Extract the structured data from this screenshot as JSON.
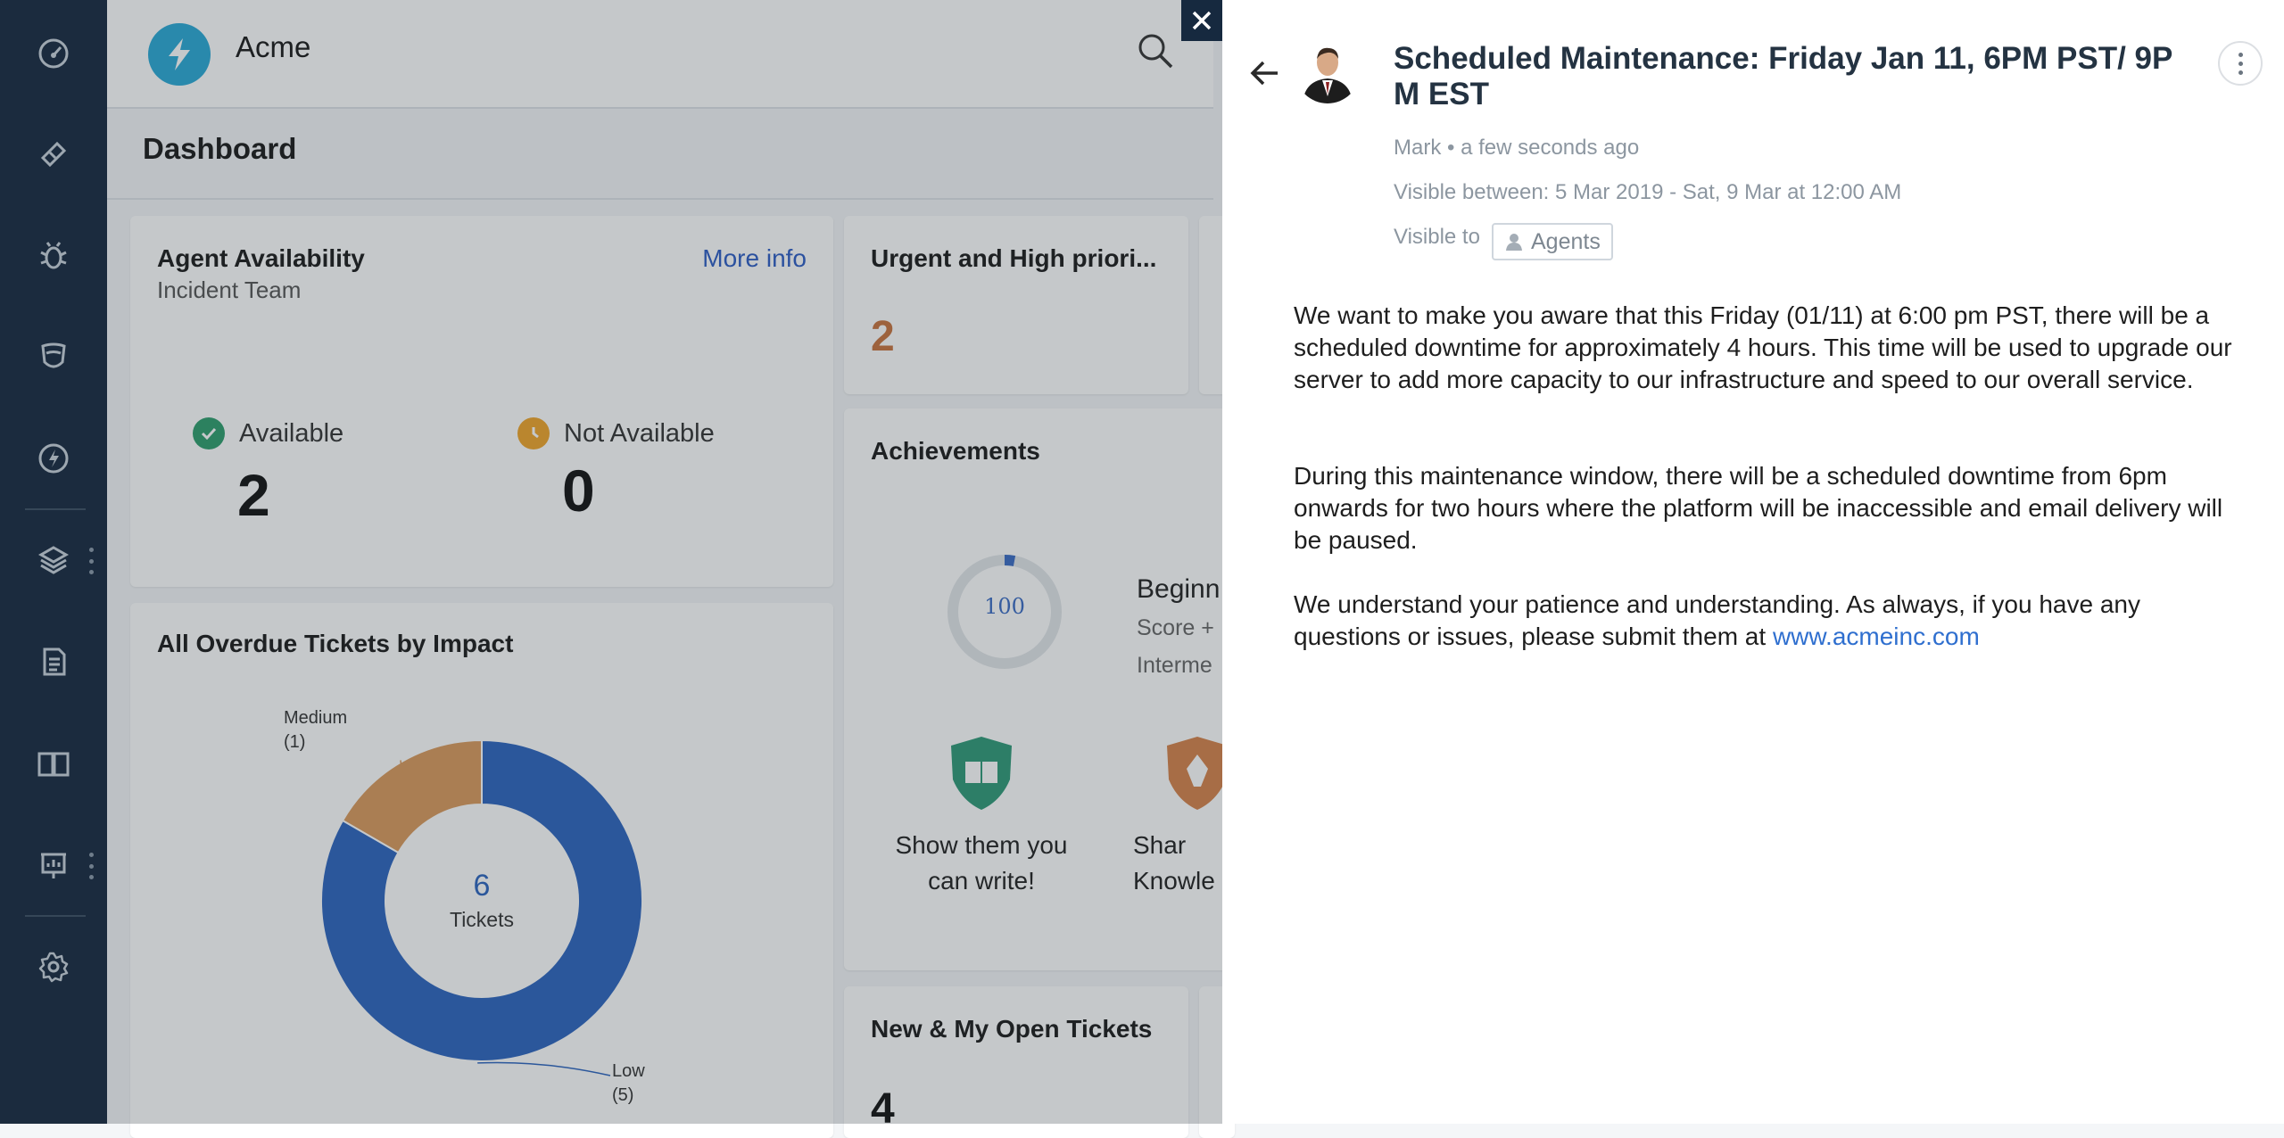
{
  "app": {
    "brand": "Acme"
  },
  "sidebar": {
    "items": [
      {
        "icon": "dashboard-icon"
      },
      {
        "icon": "ticket-icon"
      },
      {
        "icon": "bug-icon"
      },
      {
        "icon": "shield-icon"
      },
      {
        "icon": "bolt-icon"
      },
      {
        "icon": "layers-icon"
      },
      {
        "icon": "document-icon"
      },
      {
        "icon": "book-icon"
      },
      {
        "icon": "reports-icon"
      },
      {
        "icon": "gear-icon"
      }
    ]
  },
  "header": {
    "page_title": "Dashboard"
  },
  "agent_availability": {
    "title": "Agent Availability",
    "subtitle": "Incident Team",
    "link": "More info",
    "available_label": "Available",
    "available_count": "2",
    "not_available_label": "Not Available",
    "not_available_count": "0"
  },
  "urgent": {
    "title": "Urgent and High priori...",
    "count": "2"
  },
  "achievements": {
    "title": "Achievements",
    "score": "100",
    "level_partial": "Beginn",
    "score_partial": "Score +",
    "next_partial": "Interme",
    "badge1_line1": "Show them you",
    "badge1_line2": "can write!",
    "badge2_line1": "Shar",
    "badge2_line2": "Knowle"
  },
  "overdue": {
    "title": "All Overdue Tickets by Impact",
    "center_value": "6",
    "center_label": "Tickets",
    "medium_label": "Medium",
    "medium_count": "(1)",
    "low_label": "Low",
    "low_count": "(5)"
  },
  "new_open": {
    "title": "New & My Open Tickets",
    "count": "4"
  },
  "colors": {
    "sidebar": "#16293f",
    "low": "#2c64bf",
    "medium": "#db9a5c",
    "accent": "#2c5cc5"
  },
  "chart_data": {
    "type": "pie",
    "categories": [
      "Low",
      "Medium"
    ],
    "values": [
      5,
      1
    ],
    "title": "All Overdue Tickets by Impact"
  },
  "announcement": {
    "title": "Scheduled Maintenance: Friday Jan 11, 6PM PST/ 9P M EST",
    "author": "Mark • a few seconds ago",
    "visible_between": "Visible between: 5 Mar 2019 - Sat, 9 Mar at 12:00 AM",
    "visible_to_label": "Visible to",
    "visible_to_value": "Agents",
    "para1": "We want to make you aware that this Friday (01/11) at 6:00 pm PST, there will be a scheduled downtime for approximately 4 hours. This time will be used to upgrade our server to add more capacity to our infrastructure and speed to our overall service.",
    "para2": "During this maintenance window, there will be a scheduled downtime from 6pm onwards for two hours where the platform will be inaccessible and email delivery will be paused.",
    "para3_prefix": "We understand your patience and understanding. As always, if you have any questions or issues, please submit them at",
    "para3_link": "www.acmeinc.com"
  }
}
